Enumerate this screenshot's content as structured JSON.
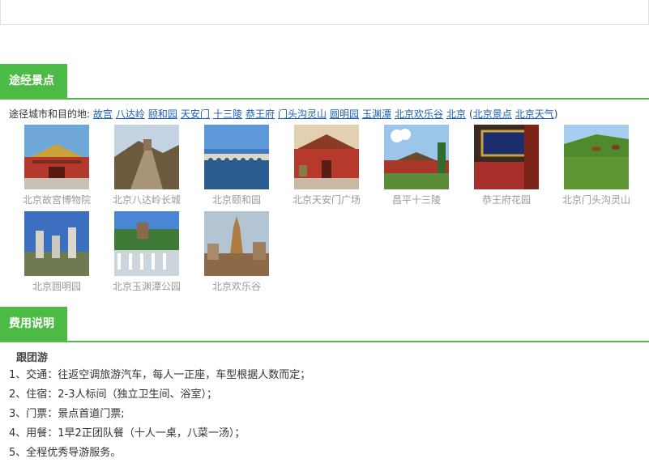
{
  "route": {
    "title": "途经景点",
    "cities_label": "途径城市和目的地:",
    "links": [
      "故宫",
      "八达岭",
      "颐和园",
      "天安门",
      "十三陵",
      "恭王府",
      "门头沟灵山",
      "圆明园",
      "玉渊潭",
      "北京欢乐谷",
      "北京"
    ],
    "extra_links": [
      "北京景点",
      "北京天气"
    ],
    "paren_open": "(",
    "paren_close": ")",
    "photos": [
      {
        "caption": "北京故宫博物院",
        "icon": "forbidden-city-photo"
      },
      {
        "caption": "北京八达岭长城",
        "icon": "great-wall-photo"
      },
      {
        "caption": "北京颐和园",
        "icon": "summer-palace-photo"
      },
      {
        "caption": "北京天安门广场",
        "icon": "tiananmen-photo"
      },
      {
        "caption": "昌平十三陵",
        "icon": "ming-tombs-photo"
      },
      {
        "caption": "恭王府花园",
        "icon": "prince-gong-photo"
      },
      {
        "caption": "北京门头沟灵山",
        "icon": "lingshan-photo"
      },
      {
        "caption": "北京圆明园",
        "icon": "yuanmingyuan-photo"
      },
      {
        "caption": "北京玉渊潭公园",
        "icon": "yuyuantan-photo"
      },
      {
        "caption": "北京欢乐谷",
        "icon": "happy-valley-photo"
      }
    ]
  },
  "fees": {
    "title": "费用说明",
    "subtitle": "跟团游",
    "items": [
      "1、交通：往返空调旅游汽车，每人一正座，车型根据人数而定；",
      "2、住宿：2-3人标间（独立卫生间、浴室）；",
      "3、门票：景点首道门票;",
      "4、用餐：1早2正团队餐（十人一桌，八菜一汤）；",
      "5、全程优秀导游服务。"
    ]
  },
  "colors": {
    "accent": "#4cbb45",
    "link": "#1a5fb4",
    "caption": "#999999"
  }
}
